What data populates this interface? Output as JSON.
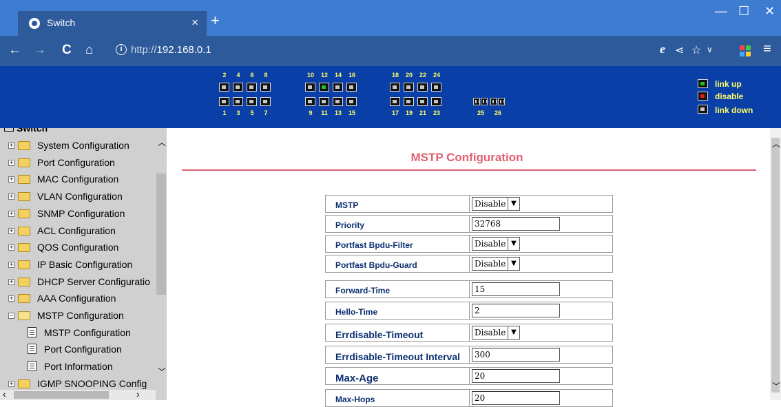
{
  "browser": {
    "tab_title": "Switch",
    "tab_close": "×",
    "new_tab": "+",
    "url_prefix": "http://",
    "url_host": "192.168.0.1",
    "back": "←",
    "forward": "→",
    "reload": "C",
    "home": "⌂",
    "minimize": "—",
    "maximize": "☐",
    "close": "✕"
  },
  "ports": {
    "top_numbers": [
      "2",
      "4",
      "6",
      "8",
      "10",
      "12",
      "14",
      "16",
      "18",
      "20",
      "22",
      "24"
    ],
    "bottom_numbers": [
      "1",
      "3",
      "5",
      "7",
      "9",
      "11",
      "13",
      "15",
      "17",
      "19",
      "21",
      "23"
    ],
    "sfp_numbers": [
      "25",
      "26"
    ],
    "up_ports": [
      "12"
    ],
    "legend": [
      "link up",
      "disable",
      "link down"
    ],
    "colors": {
      "up": "#20c020",
      "disable": "#e02020",
      "down": "#c8c8c8",
      "header_bg": "#0b3fa8",
      "legend_text": "#ffff66"
    }
  },
  "sidebar": {
    "root": "Switch",
    "items": [
      {
        "label": "System Configuration",
        "expanded": false
      },
      {
        "label": "Port Configuration",
        "expanded": false
      },
      {
        "label": "MAC Configuration",
        "expanded": false
      },
      {
        "label": "VLAN Configuration",
        "expanded": false
      },
      {
        "label": "SNMP Configuration",
        "expanded": false
      },
      {
        "label": "ACL Configuration",
        "expanded": false
      },
      {
        "label": "QOS Configuration",
        "expanded": false
      },
      {
        "label": "IP Basic Configuration",
        "expanded": false
      },
      {
        "label": "DHCP Server Configuratio",
        "expanded": false
      },
      {
        "label": "AAA Configuration",
        "expanded": false
      },
      {
        "label": "MSTP Configuration",
        "expanded": true
      },
      {
        "label": "IGMP SNOOPING Config",
        "expanded": false
      }
    ],
    "subitems": [
      "MSTP Configuration",
      "Port Configuration",
      "Port Information"
    ]
  },
  "main": {
    "title": "MSTP Configuration",
    "title_color": "#e06070",
    "rows": [
      {
        "label": "MSTP",
        "type": "select",
        "value": "Disable"
      },
      {
        "label": "Priority",
        "type": "input",
        "value": "32768"
      },
      {
        "label": "Portfast Bpdu-Filter",
        "type": "select",
        "value": "Disable"
      },
      {
        "label": "Portfast Bpdu-Guard",
        "type": "select",
        "value": "Disable"
      },
      {
        "label": "Forward-Time",
        "type": "input",
        "value": "15"
      },
      {
        "label": "Hello-Time",
        "type": "input",
        "value": "2"
      },
      {
        "label": "Errdisable-Timeout",
        "type": "select",
        "value": "Disable"
      },
      {
        "label": "Errdisable-Timeout Interval",
        "type": "input",
        "value": "300"
      },
      {
        "label": "Max-Age",
        "type": "input",
        "value": "20"
      },
      {
        "label": "Max-Hops",
        "type": "input",
        "value": "20"
      }
    ]
  }
}
